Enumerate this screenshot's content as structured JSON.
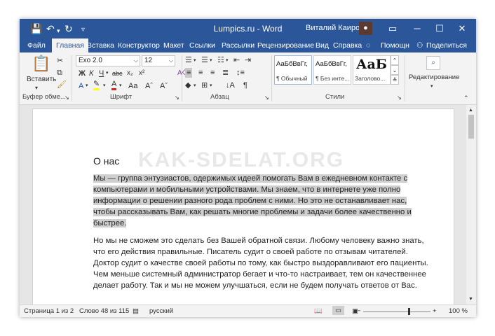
{
  "titlebar": {
    "title": "Lumpics.ru  -  Word",
    "user": "Виталий Каиров",
    "colors": {
      "bar": "#2b579a"
    }
  },
  "tabs": [
    "Файл",
    "Главная",
    "Вставка",
    "Конструктор",
    "Макет",
    "Ссылки",
    "Рассылки",
    "Рецензирование",
    "Вид",
    "Справка",
    "Помощн",
    "Поделиться"
  ],
  "ribbon": {
    "paste_label": "Вставить",
    "clipboard_label": "Буфер обме...",
    "font_label": "Шрифт",
    "paragraph_label": "Абзац",
    "styles_label": "Стили",
    "font_name": "Exo 2.0",
    "font_size": "12",
    "styles": [
      {
        "sample": "АаБбВвГг,",
        "name": "¶ Обычный"
      },
      {
        "sample": "АаБбВвГг,",
        "name": "¶ Без инте..."
      },
      {
        "sample": "АаБ",
        "name": "Заголово..."
      }
    ],
    "editing_label": "Редактирование"
  },
  "document": {
    "heading": "О нас",
    "watermark": "KAK-SDELAT.ORG",
    "para1": "Мы — группа энтузиастов, одержимых идеей помогать Вам в ежедневном контакте с компьютерами и мобильными устройствами. Мы знаем, что в интернете уже полно информации о решении разного рода проблем с ними. Но это не останавливает нас, чтобы рассказывать Вам, как решать многие проблемы и задачи более качественно и быстрее.",
    "para2": "Но мы не сможем это сделать без Вашей обратной связи. Любому человеку важно знать, что его действия правильные. Писатель судит о своей работе по отзывам читателей. Доктор судит о качестве своей работы по тому, как быстро выздоравливают его пациенты. Чем меньше системный администратор бегает и что-то настраивает, тем он качественнее делает работу. Так и мы не можем улучшаться, если не будем получать ответов от Вас."
  },
  "status": {
    "page": "Страница 1 из 2",
    "words": "Слово 48 из 115",
    "language": "русский",
    "zoom": "100 %"
  }
}
